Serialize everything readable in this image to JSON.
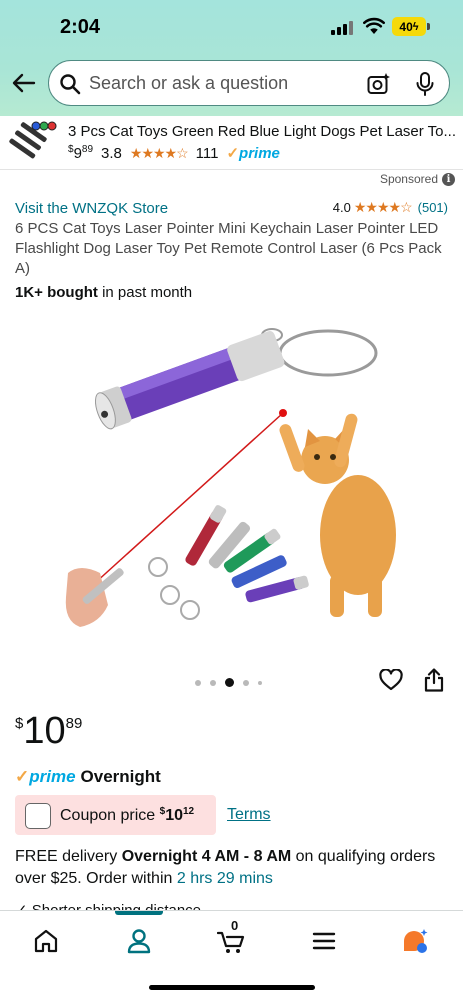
{
  "status_bar": {
    "time": "2:04",
    "battery": "40"
  },
  "search": {
    "placeholder": "Search or ask a question"
  },
  "sponsored_strip": {
    "title": "3 Pcs Cat Toys Green Red Blue Light Dogs Pet Laser To...",
    "price_symbol": "$",
    "price_whole": "9",
    "price_fraction": "89",
    "rating": "3.8",
    "stars": 3.8,
    "review_count": "111",
    "prime_label": "prime"
  },
  "sponsored_label": "Sponsored",
  "product": {
    "store_link": "Visit the WNZQK Store",
    "rating": "4.0",
    "stars": 4.0,
    "rating_count": "(501)",
    "title": "6 PCS Cat Toys Laser Pointer Mini Keychain Laser Pointer LED Flashlight Dog Laser Toy Pet Remote Control Laser (6 Pcs Pack A)",
    "bought_bold": "1K+ bought",
    "bought_rest": "in past month",
    "image_count": 5,
    "active_image_index": 2,
    "price_symbol": "$",
    "price_whole": "10",
    "price_fraction": "89"
  },
  "prime": {
    "logo": "prime",
    "delivery": "Overnight"
  },
  "coupon": {
    "label": "Coupon price",
    "price_symbol": "$",
    "price": "10",
    "price_fraction": "12",
    "terms": "Terms"
  },
  "delivery": {
    "prefix": "FREE delivery",
    "window": "Overnight 4 AM - 8 AM",
    "middle": "on qualifying orders over $25. Order within",
    "countdown": "2 hrs 29 mins"
  },
  "shorter_shipping": "Shorter shipping distance",
  "tabbar": {
    "active_tab": "account",
    "cart_count": "0",
    "tabs": [
      {
        "name": "home",
        "icon": "home-icon"
      },
      {
        "name": "account",
        "icon": "person-icon"
      },
      {
        "name": "cart",
        "icon": "cart-icon"
      },
      {
        "name": "menu",
        "icon": "menu-icon"
      },
      {
        "name": "rufus",
        "icon": "rufus-icon"
      }
    ]
  },
  "colors": {
    "header_gradient_start": "#a4e4dc",
    "link_teal": "#007185",
    "prime_blue": "#00a8e1",
    "star_orange": "#de7921",
    "coupon_bg": "#fde0e0",
    "tab_active": "#00727f"
  }
}
